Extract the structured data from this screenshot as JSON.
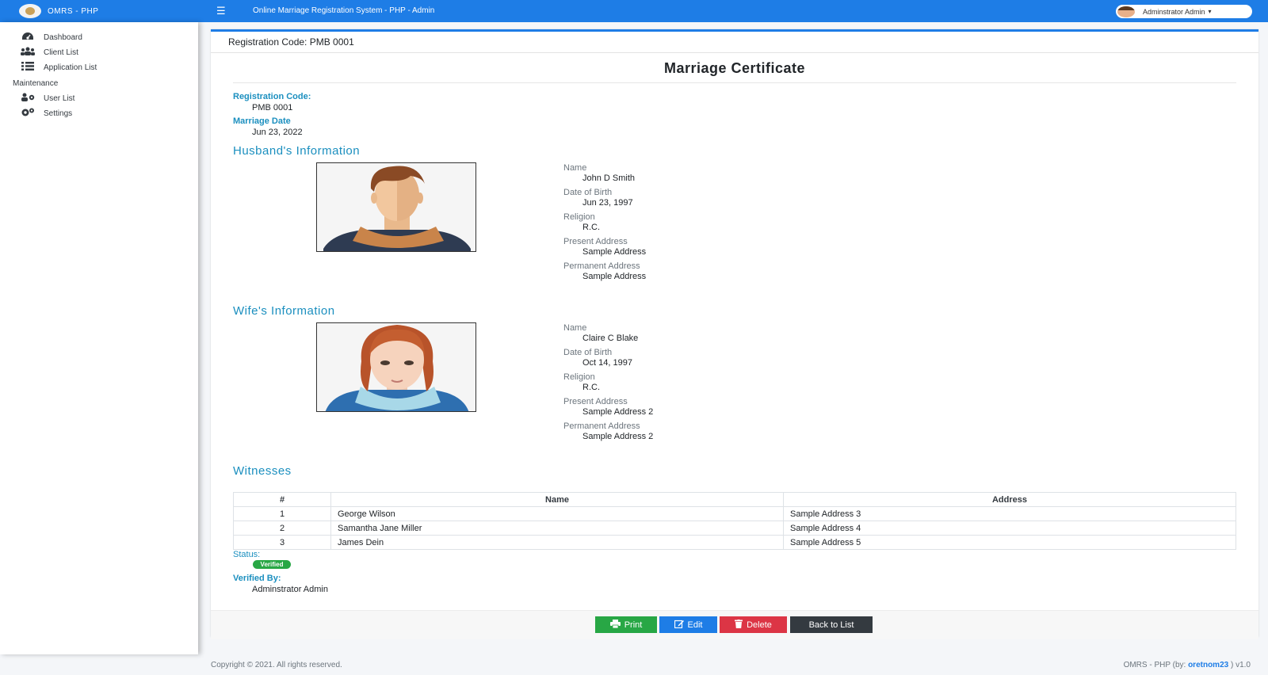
{
  "brand": {
    "text": "OMRS - PHP"
  },
  "header": {
    "title": "Online Marriage Registration System - PHP - Admin",
    "user_name": "Adminstrator Admin",
    "caret": "▾",
    "menu_icon": "hamburger-icon"
  },
  "sidebar": {
    "items": [
      {
        "label": "Dashboard",
        "icon": "tachometer-icon"
      },
      {
        "label": "Client List",
        "icon": "users-icon"
      },
      {
        "label": "Application List",
        "icon": "list-icon"
      }
    ],
    "maintenance_header": "Maintenance",
    "maintenance_items": [
      {
        "label": "User List",
        "icon": "users-cog-icon"
      },
      {
        "label": "Settings",
        "icon": "cogs-icon"
      }
    ]
  },
  "card": {
    "header_title": "Registration Code: PMB 0001",
    "cert_title": "Marriage Certificate",
    "registration_code_label": "Registration Code:",
    "registration_code": "PMB 0001",
    "marriage_date_label": "Marriage Date",
    "marriage_date": "Jun 23, 2022"
  },
  "husband": {
    "section_title": "Husband's Information",
    "name_label": "Name",
    "name": "John D Smith",
    "dob_label": "Date of Birth",
    "dob": "Jun 23, 1997",
    "religion_label": "Religion",
    "religion": "R.C.",
    "present_label": "Present Address",
    "present": "Sample Address",
    "permanent_label": "Permanent Address",
    "permanent": "Sample Address"
  },
  "wife": {
    "section_title": "Wife's Information",
    "name_label": "Name",
    "name": "Claire C Blake",
    "dob_label": "Date of Birth",
    "dob": "Oct 14, 1997",
    "religion_label": "Religion",
    "religion": "R.C.",
    "present_label": "Present Address",
    "present": "Sample Address 2",
    "permanent_label": "Permanent Address",
    "permanent": "Sample Address 2"
  },
  "witnesses": {
    "section_title": "Witnesses",
    "columns": [
      "#",
      "Name",
      "Address"
    ],
    "rows": [
      {
        "num": "1",
        "name": "George Wilson",
        "address": "Sample Address 3"
      },
      {
        "num": "2",
        "name": "Samantha Jane Miller",
        "address": "Sample Address 4"
      },
      {
        "num": "3",
        "name": "James Dein",
        "address": "Sample Address 5"
      }
    ]
  },
  "status": {
    "label": "Status:",
    "badge": "Verified",
    "verified_by_label": "Verified By:",
    "verified_by": "Adminstrator Admin"
  },
  "actions": {
    "print": "Print",
    "edit": "Edit",
    "delete": "Delete",
    "back": "Back to List"
  },
  "footer": {
    "copyright": "Copyright © 2021. All rights reserved.",
    "right_prefix": "OMRS - PHP (by: ",
    "right_link": "oretnom23",
    "right_suffix": " ) v1.0"
  },
  "colors": {
    "primary": "#1e7de6",
    "accent_text": "#1b8fbf",
    "success": "#28a745",
    "danger": "#dc3545",
    "dark": "#343a40"
  }
}
